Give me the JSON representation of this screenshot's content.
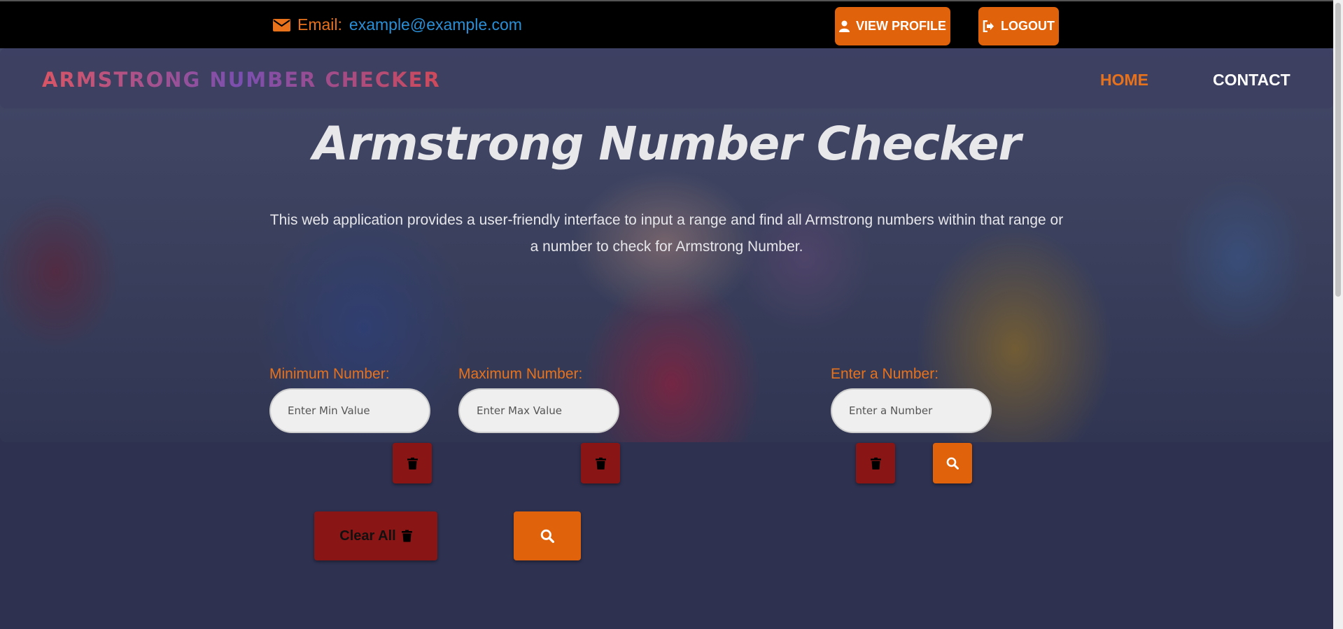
{
  "topbar": {
    "email_label": "Email:",
    "email_address": "example@example.com",
    "view_profile": "VIEW PROFILE",
    "logout": "LOGOUT"
  },
  "nav": {
    "brand": "ARMSTRONG NUMBER CHECKER",
    "home": "HOME",
    "contact": "CONTACT"
  },
  "hero": {
    "title": "Armstrong Number Checker",
    "description": "This web application provides a user-friendly interface to input a range and find all Armstrong numbers within that range or a number to check for Armstrong Number."
  },
  "form": {
    "min_label": "Minimum Number:",
    "min_placeholder": "Enter Min Value",
    "max_label": "Maximum Number:",
    "max_placeholder": "Enter Max Value",
    "number_label": "Enter a Number:",
    "number_placeholder": "Enter a Number",
    "clear_all": "Clear All"
  },
  "icons": {
    "email": "envelope-icon",
    "profile": "user-icon",
    "logout": "sign-out-icon",
    "delete": "trash-icon",
    "search": "search-icon"
  },
  "colors": {
    "accent": "#e0620a",
    "danger": "#8a1515",
    "link": "#2a8fd6",
    "background": "#2e3150"
  }
}
